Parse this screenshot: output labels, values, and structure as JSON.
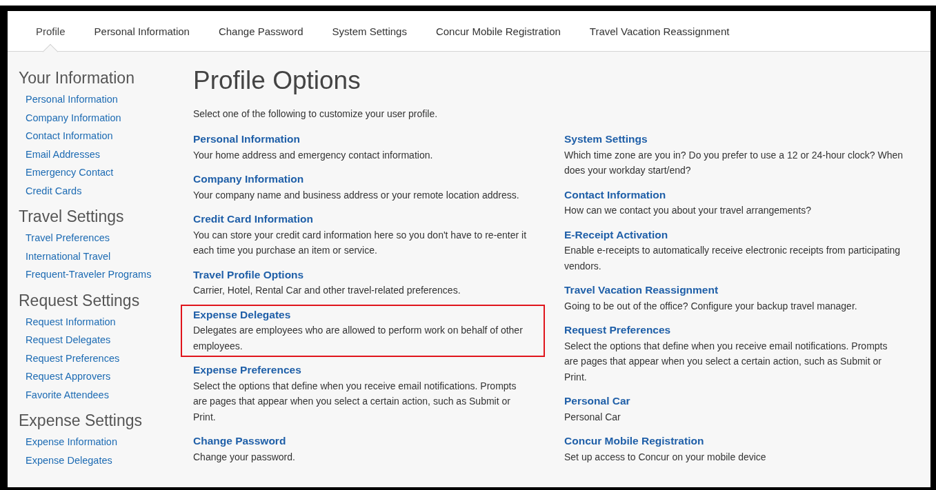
{
  "tabs": [
    {
      "label": "Profile",
      "selected": true
    },
    {
      "label": "Personal Information",
      "selected": false
    },
    {
      "label": "Change Password",
      "selected": false
    },
    {
      "label": "System Settings",
      "selected": false
    },
    {
      "label": "Concur Mobile Registration",
      "selected": false
    },
    {
      "label": "Travel Vacation Reassignment",
      "selected": false
    }
  ],
  "sidebar": {
    "sections": [
      {
        "heading": "Your Information",
        "links": [
          "Personal Information",
          "Company Information",
          "Contact Information",
          "Email Addresses",
          "Emergency Contact",
          "Credit Cards"
        ]
      },
      {
        "heading": "Travel Settings",
        "links": [
          "Travel Preferences",
          "International Travel",
          "Frequent-Traveler Programs"
        ]
      },
      {
        "heading": "Request Settings",
        "links": [
          "Request Information",
          "Request Delegates",
          "Request Preferences",
          "Request Approvers",
          "Favorite Attendees"
        ]
      },
      {
        "heading": "Expense Settings",
        "links": [
          "Expense Information",
          "Expense Delegates"
        ]
      }
    ]
  },
  "main": {
    "title": "Profile Options",
    "intro": "Select one of the following to customize your user profile.",
    "columns": [
      [
        {
          "title": "Personal Information",
          "description": "Your home address and emergency contact information.",
          "highlighted": false
        },
        {
          "title": "Company Information",
          "description": "Your company name and business address or your remote location address.",
          "highlighted": false
        },
        {
          "title": "Credit Card Information",
          "description": "You can store your credit card information here so you don't have to re-enter it each time you purchase an item or service.",
          "highlighted": false
        },
        {
          "title": "Travel Profile Options",
          "description": "Carrier, Hotel, Rental Car and other travel-related preferences.",
          "highlighted": false
        },
        {
          "title": "Expense Delegates",
          "description": "Delegates are employees who are allowed to perform work on behalf of other employees.",
          "highlighted": true
        },
        {
          "title": "Expense Preferences",
          "description": "Select the options that define when you receive email notifications. Prompts are pages that appear when you select a certain action, such as Submit or Print.",
          "highlighted": false
        },
        {
          "title": "Change Password",
          "description": "Change your password.",
          "highlighted": false
        }
      ],
      [
        {
          "title": "System Settings",
          "description": "Which time zone are you in? Do you prefer to use a 12 or 24-hour clock? When does your workday start/end?",
          "highlighted": false
        },
        {
          "title": "Contact Information",
          "description": "How can we contact you about your travel arrangements?",
          "highlighted": false
        },
        {
          "title": "E-Receipt Activation",
          "description": "Enable e-receipts to automatically receive electronic receipts from participating vendors.",
          "highlighted": false
        },
        {
          "title": "Travel Vacation Reassignment",
          "description": "Going to be out of the office? Configure your backup travel manager.",
          "highlighted": false
        },
        {
          "title": "Request Preferences",
          "description": "Select the options that define when you receive email notifications. Prompts are pages that appear when you select a certain action, such as Submit or Print.",
          "highlighted": false
        },
        {
          "title": "Personal Car",
          "description": "Personal Car",
          "highlighted": false
        },
        {
          "title": "Concur Mobile Registration",
          "description": "Set up access to Concur on your mobile device",
          "highlighted": false
        }
      ]
    ]
  }
}
